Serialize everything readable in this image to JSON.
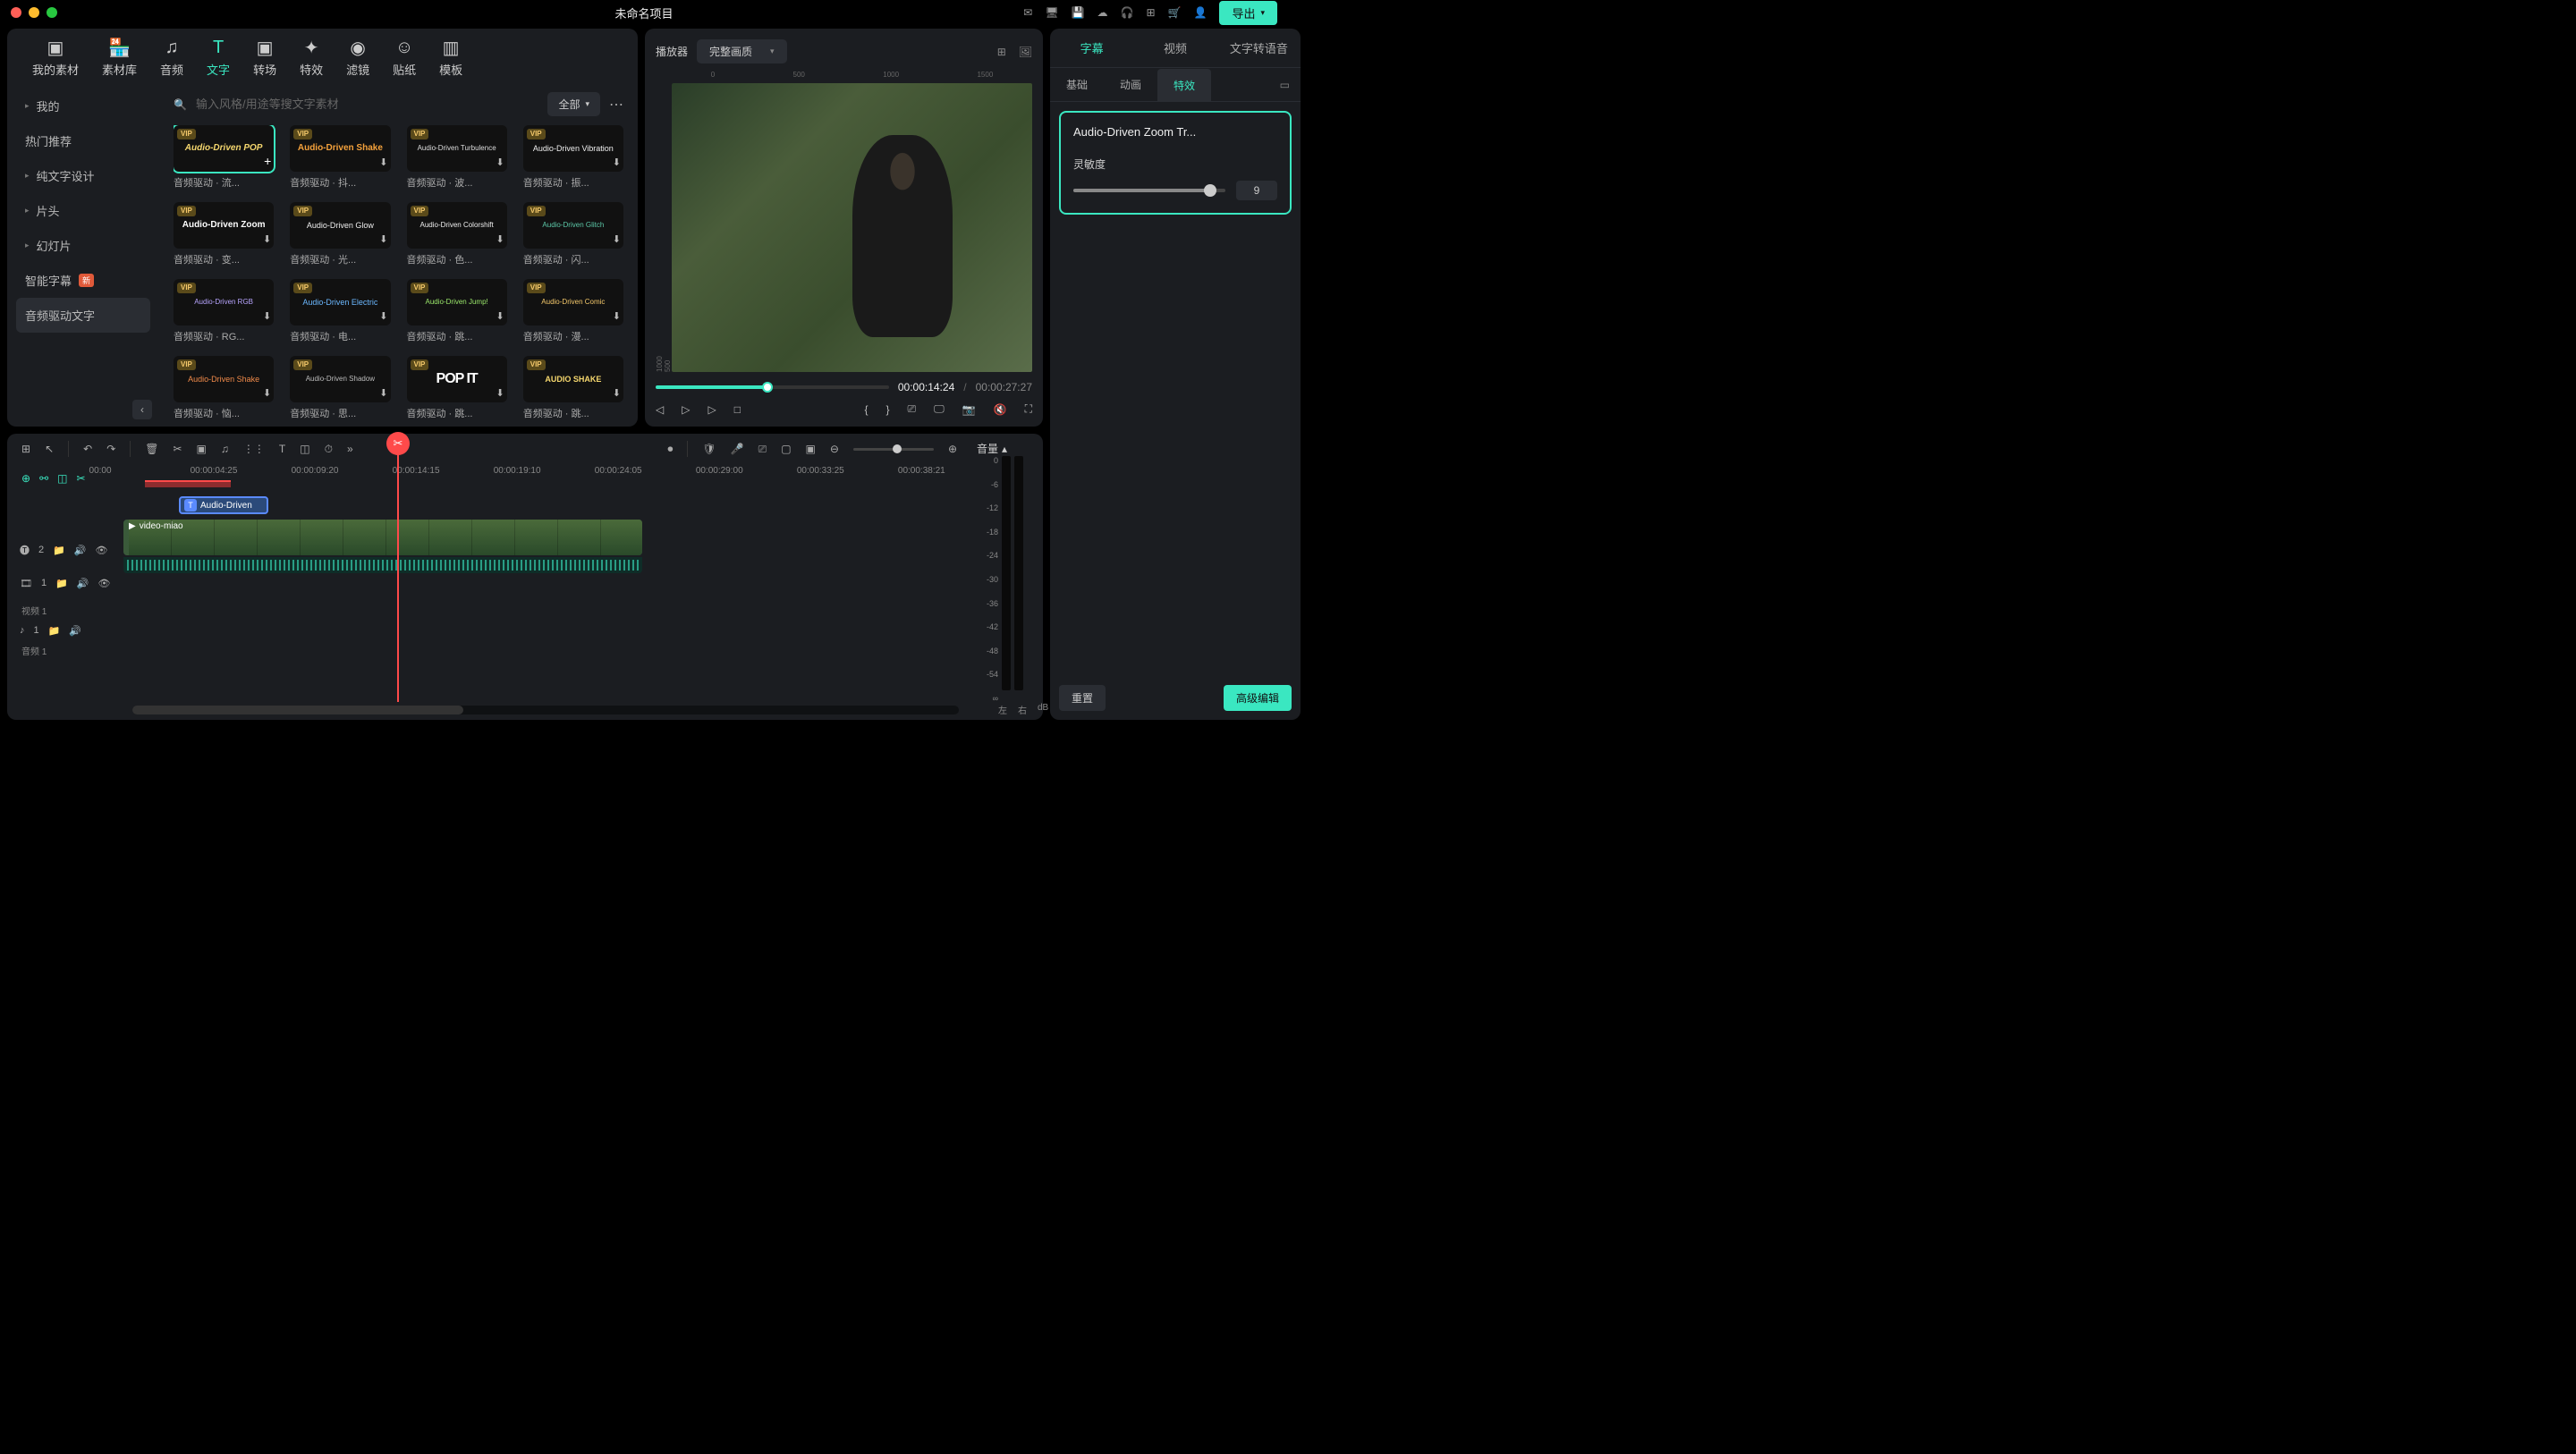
{
  "titlebar": {
    "title": "未命名项目",
    "export": "导出"
  },
  "top_tabs": {
    "media": "我的素材",
    "stock": "素材库",
    "audio": "音频",
    "text": "文字",
    "transition": "转场",
    "effect": "特效",
    "filter": "滤镜",
    "sticker": "贴纸",
    "template": "模板"
  },
  "sidebar": {
    "items": [
      {
        "label": "我的",
        "chev": true
      },
      {
        "label": "热门推荐"
      },
      {
        "label": "纯文字设计",
        "chev": true
      },
      {
        "label": "片头",
        "chev": true
      },
      {
        "label": "幻灯片",
        "chev": true
      },
      {
        "label": "智能字幕",
        "new": "新"
      },
      {
        "label": "音频驱动文字",
        "active": true
      }
    ]
  },
  "search": {
    "placeholder": "输入风格/用途等搜文字素材",
    "all": "全部"
  },
  "fx": [
    {
      "name": "Audio-Driven POP",
      "label": "音频驱动 · 流...",
      "cls": "th-pop",
      "selected": true,
      "add": true
    },
    {
      "name": "Audio-Driven Shake",
      "label": "音频驱动 · 抖...",
      "cls": "th-shake"
    },
    {
      "name": "Audio-Driven Turbulence",
      "label": "音频驱动 · 波...",
      "cls": "th-turb"
    },
    {
      "name": "Audio-Driven Vibration",
      "label": "音频驱动 · 振...",
      "cls": "th-vib"
    },
    {
      "name": "Audio-Driven Zoom",
      "label": "音频驱动 · 变...",
      "cls": "th-zoom"
    },
    {
      "name": "Audio-Driven Glow",
      "label": "音频驱动 · 光...",
      "cls": "th-glow"
    },
    {
      "name": "Audio-Driven Colorshift",
      "label": "音频驱动 · 色...",
      "cls": "th-color"
    },
    {
      "name": "Audio-Driven Glitch",
      "label": "音频驱动 · 闪...",
      "cls": "th-glitch"
    },
    {
      "name": "Audio-Driven RGB",
      "label": "音频驱动 · RG...",
      "cls": "th-rgb"
    },
    {
      "name": "Audio-Driven Electric",
      "label": "音频驱动 · 电...",
      "cls": "th-elec"
    },
    {
      "name": "Audio-Driven Jump!",
      "label": "音频驱动 · 跳...",
      "cls": "th-jump"
    },
    {
      "name": "Audio-Driven Comic",
      "label": "音频驱动 · 漫...",
      "cls": "th-comic"
    },
    {
      "name": "Audio-Driven Shake",
      "label": "音频驱动 · 恼...",
      "cls": "th-shake2"
    },
    {
      "name": "Audio-Driven Shadow",
      "label": "音频驱动 · 思...",
      "cls": "th-shadow"
    },
    {
      "name": "POP IT",
      "label": "音频驱动 · 跳...",
      "cls": "th-popit"
    },
    {
      "name": "AUDIO SHAKE",
      "label": "音频驱动 · 跳...",
      "cls": "th-as"
    }
  ],
  "player": {
    "label": "播放器",
    "quality": "完整画质",
    "time_current": "00:00:14:24",
    "time_duration": "00:00:27:27"
  },
  "inspector": {
    "tabs": {
      "subtitle": "字幕",
      "video": "视频",
      "tts": "文字转语音"
    },
    "subtabs": {
      "basic": "基础",
      "anim": "动画",
      "effect": "特效"
    },
    "fx_title": "Audio-Driven Zoom Tr...",
    "sensitivity_label": "灵敏度",
    "sensitivity_value": "9",
    "reset": "重置",
    "advanced": "高级编辑"
  },
  "timeline": {
    "ruler": [
      "00:00",
      "00:00:04:25",
      "00:00:09:20",
      "00:00:14:15",
      "00:00:19:10",
      "00:00:24:05",
      "00:00:29:00",
      "00:00:33:25",
      "00:00:38:21"
    ],
    "text_clip": "Audio-Driven",
    "video_clip": "video-miao",
    "track2_badge": "2",
    "track1_badge": "1",
    "audio_badge": "1",
    "video_label": "视频 1",
    "audio_label": "音频 1",
    "volume": "音量",
    "L": "左",
    "R": "右",
    "db": "dB",
    "meter": [
      "0",
      "-6",
      "-12",
      "-18",
      "-24",
      "-30",
      "-36",
      "-42",
      "-48",
      "-54",
      "∞"
    ]
  }
}
